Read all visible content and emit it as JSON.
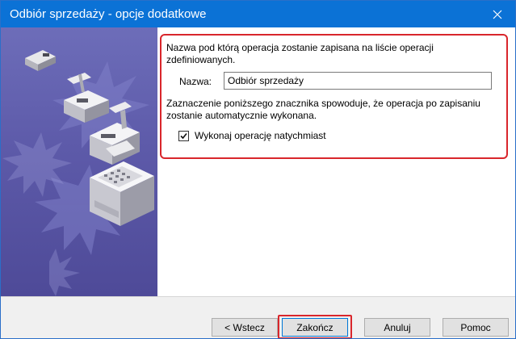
{
  "window": {
    "title": "Odbiór sprzedaży - opcje dodatkowe",
    "close_icon": "close-icon"
  },
  "illustration": {
    "name": "cash-registers-illustration",
    "background_color": "#5d5aa9"
  },
  "content": {
    "name_description": "Nazwa pod którą operacja zostanie zapisana na liście operacji zdefiniowanych.",
    "name_label": "Nazwa:",
    "name_value": "Odbiór sprzedaży",
    "checkbox_description": "Zaznaczenie poniższego znacznika spowoduje, że operacja po zapisaniu zostanie automatycznie wykonana.",
    "checkbox_label": "Wykonaj operację natychmiast",
    "checkbox_checked": true
  },
  "buttons": {
    "back": "< Wstecz",
    "finish": "Zakończ",
    "cancel": "Anuluj",
    "help": "Pomoc"
  },
  "colors": {
    "titlebar": "#0b72d6",
    "highlight": "#d9262c"
  }
}
